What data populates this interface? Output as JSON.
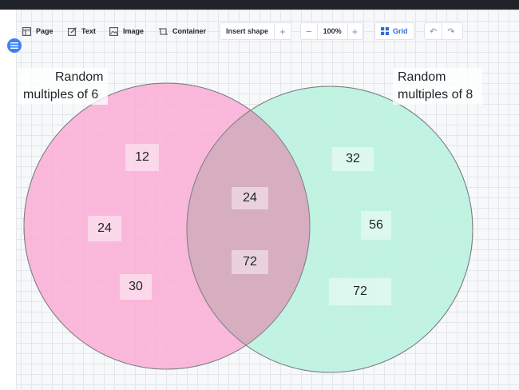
{
  "toolbar": {
    "page_label": "Page",
    "text_label": "Text",
    "image_label": "Image",
    "container_label": "Container",
    "insert_shape_label": "Insert shape",
    "zoom_level": "100%",
    "grid_label": "Grid"
  },
  "colors": {
    "left_circle_fill": "#fbaed6",
    "right_circle_fill": "#b9f2dd",
    "accent": "#3b82f6"
  },
  "icons": {
    "page": "page-layout-icon",
    "text": "text-edit-icon",
    "image": "image-icon",
    "container": "container-icon",
    "plus": "plus-icon",
    "minus": "minus-icon",
    "grid": "grid-icon",
    "undo": "undo-icon",
    "redo": "redo-icon",
    "menu": "menu-icon"
  },
  "venn": {
    "left_set": {
      "title_line1": "Random",
      "title_line2": "multiples of 6",
      "only_values": [
        "12",
        "24",
        "30"
      ]
    },
    "right_set": {
      "title_line1": "Random",
      "title_line2": "multiples of 8",
      "only_values": [
        "32",
        "56",
        "72"
      ]
    },
    "intersection_values": [
      "24",
      "72"
    ]
  }
}
